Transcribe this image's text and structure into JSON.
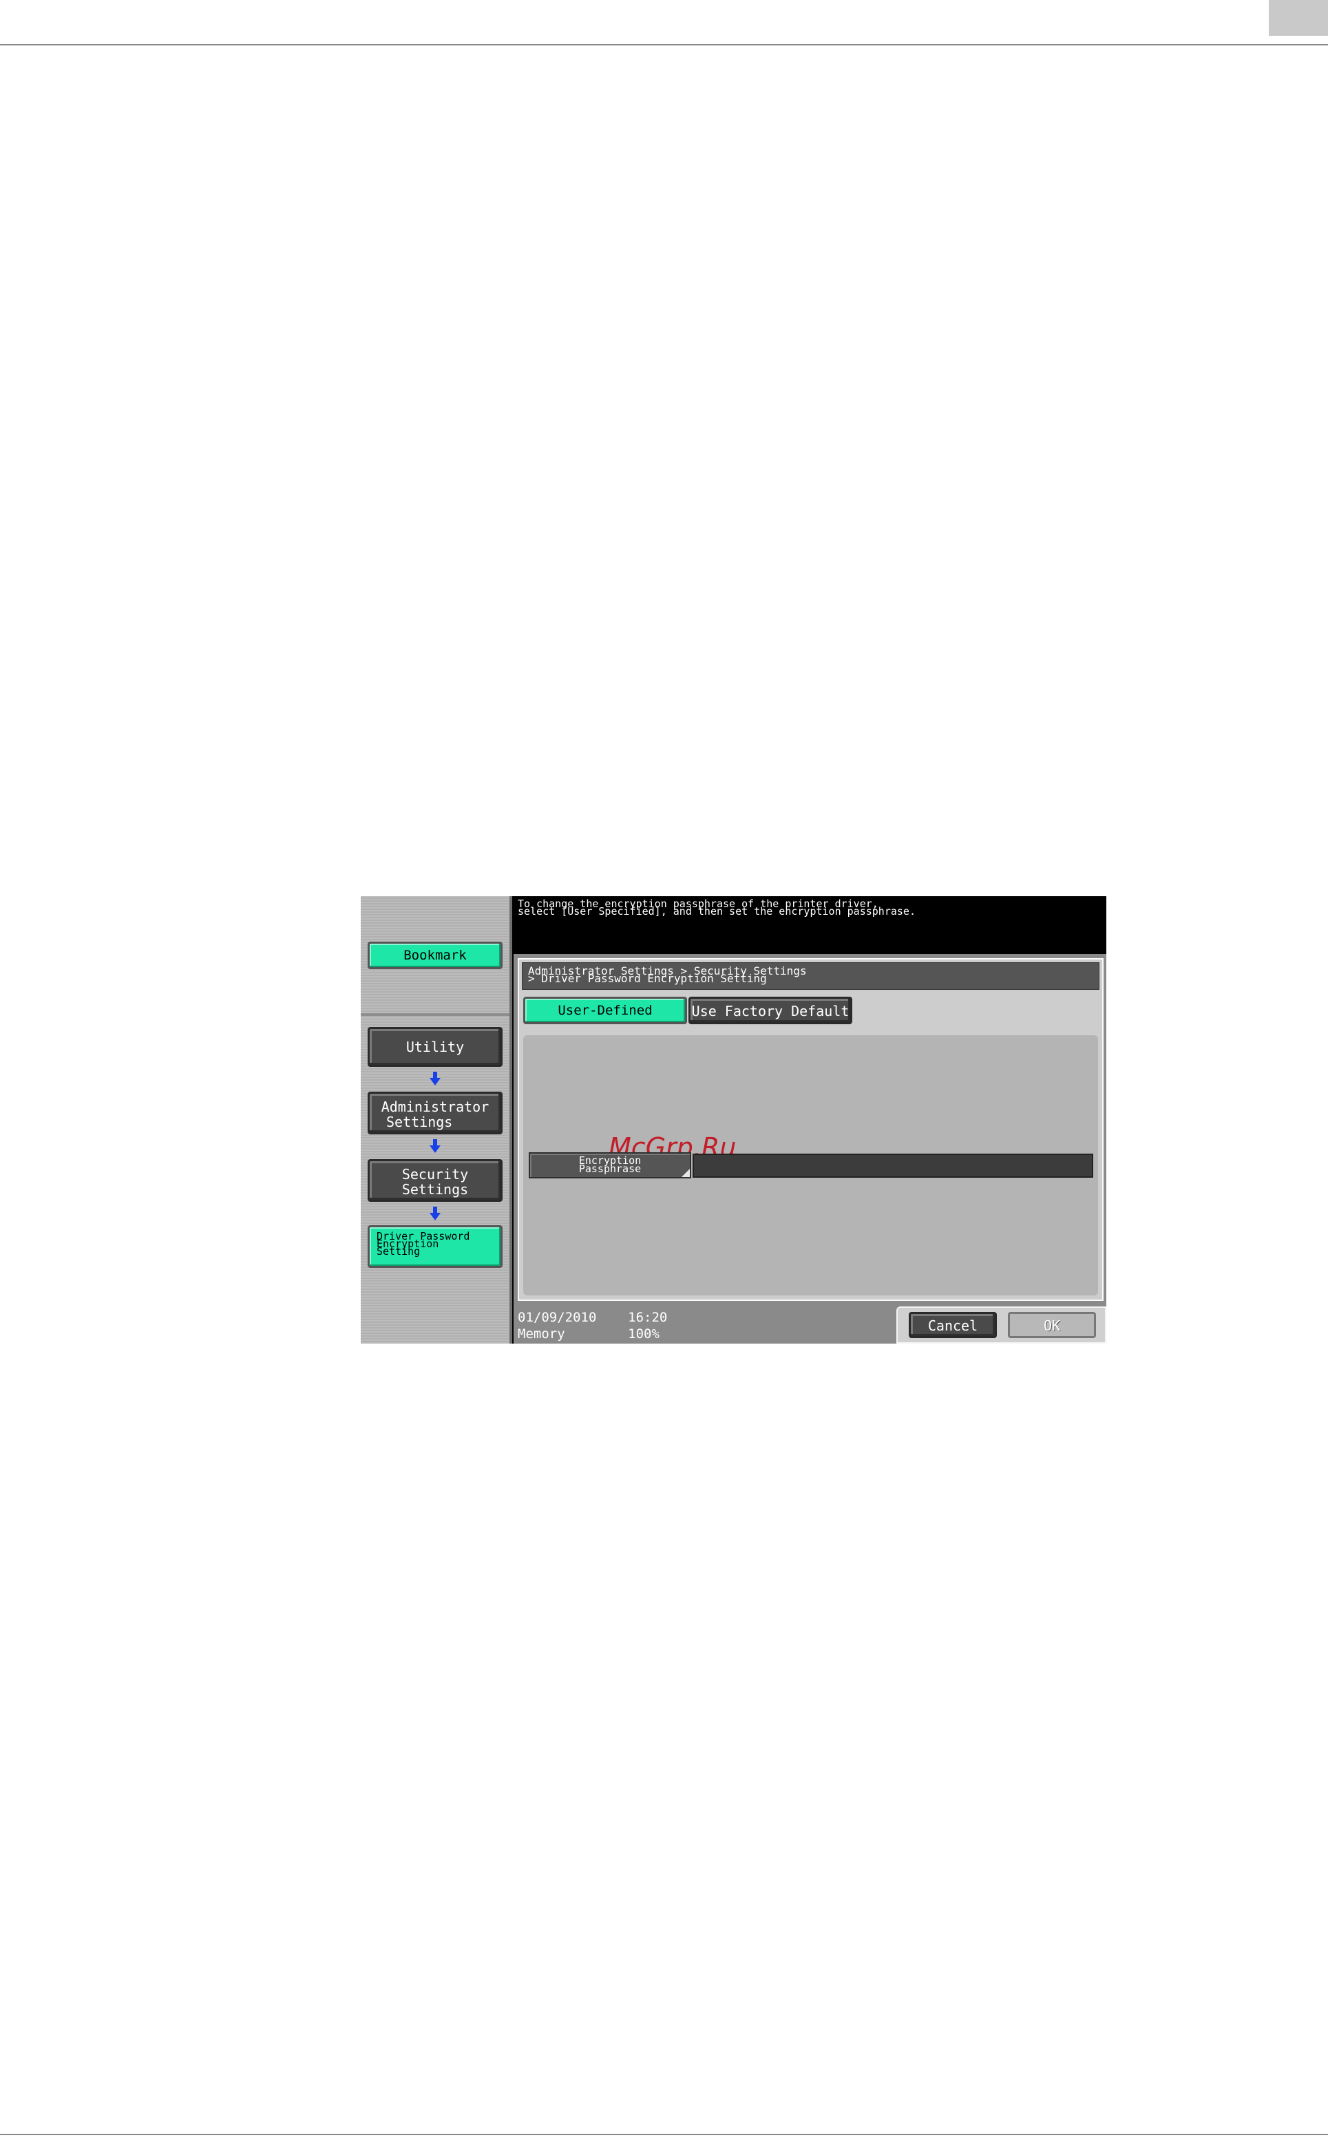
{
  "panel": {
    "message_line1": "To change the encryption passphrase of the printer driver,",
    "message_line2": "select [User Specified], and then set the encryption passphrase.",
    "sidebar": {
      "bookmark_label": "Bookmark",
      "utility_label": "Utility",
      "admin_line1": "Administrator",
      "admin_line2": "Settings",
      "security_line1": "Security",
      "security_line2": "Settings",
      "driver_line1": "Driver Password",
      "driver_line2": "Encryption",
      "driver_line3": "Setting"
    },
    "breadcrumb_line1": "Administrator Settings > Security Settings",
    "breadcrumb_line2": "> Driver Password Encryption Setting",
    "tabs": {
      "user_defined": "User-Defined",
      "factory_default": "Use Factory Default"
    },
    "watermark": "McGrp.Ru",
    "field": {
      "label_line1": "Encryption",
      "label_line2": "Passphrase",
      "value": ""
    },
    "status": {
      "date": "01/09/2010",
      "time": "16:20",
      "memory_label": "Memory",
      "memory_value": "100%"
    },
    "buttons": {
      "cancel": "Cancel",
      "ok": "OK"
    },
    "colors": {
      "accent_green": "#1ee6a6",
      "button_gray": "#4a4a4a",
      "arrow_blue": "#1840e8",
      "watermark_red": "#c21e2a"
    }
  }
}
